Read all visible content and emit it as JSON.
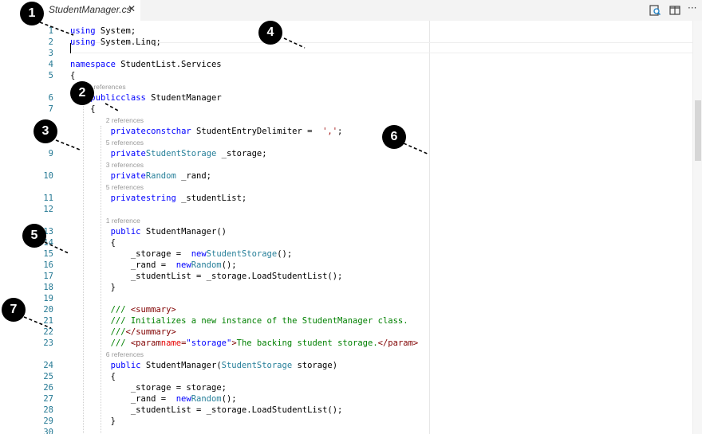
{
  "tab": {
    "title": "StudentManager.cs",
    "close": "✕"
  },
  "toolbar": {
    "icons": [
      "open-changes-icon",
      "split-editor-icon",
      "more-actions-icon"
    ],
    "more_label": "···"
  },
  "lines": [
    {
      "n": "1",
      "code": [
        [
          "kw",
          "using"
        ],
        [
          "",
          "System;"
        ]
      ]
    },
    {
      "n": "2",
      "code": [
        [
          "kw",
          "using"
        ],
        [
          "",
          "System.Linq;"
        ]
      ]
    },
    {
      "n": "3",
      "code": []
    },
    {
      "n": "4",
      "code": [
        [
          "kw",
          "namespace"
        ],
        [
          "",
          "StudentList.Services"
        ]
      ]
    },
    {
      "n": "5",
      "code": [
        [
          "",
          "{"
        ]
      ]
    },
    {
      "n": "6",
      "lens": "2 references",
      "code": [
        [
          "",
          "    "
        ],
        [
          "kw",
          "public"
        ],
        [
          "",
          ""
        ],
        [
          "kw",
          "class"
        ],
        [
          "",
          "StudentManager"
        ]
      ]
    },
    {
      "n": "7",
      "code": [
        [
          "",
          "    {"
        ]
      ]
    },
    {
      "n": "8",
      "lens": "2 references",
      "code": [
        [
          "",
          "        "
        ],
        [
          "kw",
          "private"
        ],
        [
          "",
          ""
        ],
        [
          "kw",
          "const"
        ],
        [
          "",
          ""
        ],
        [
          "kw",
          "char"
        ],
        [
          "",
          "StudentEntryDelimiter = "
        ],
        [
          "str",
          "','"
        ],
        [
          "",
          ";"
        ]
      ]
    },
    {
      "n": "9",
      "lens": "5 references",
      "code": [
        [
          "",
          "        "
        ],
        [
          "kw",
          "private"
        ],
        [
          "",
          ""
        ],
        [
          "ty",
          "StudentStorage"
        ],
        [
          "",
          "_storage;"
        ]
      ]
    },
    {
      "n": "10",
      "lens": "3 references",
      "code": [
        [
          "",
          "        "
        ],
        [
          "kw",
          "private"
        ],
        [
          "",
          ""
        ],
        [
          "ty",
          "Random"
        ],
        [
          "",
          "_rand;"
        ]
      ]
    },
    {
      "n": "11",
      "lens": "5 references",
      "code": [
        [
          "",
          "        "
        ],
        [
          "kw",
          "private"
        ],
        [
          "",
          ""
        ],
        [
          "kw",
          "string"
        ],
        [
          "",
          "_studentList;"
        ]
      ]
    },
    {
      "n": "12",
      "code": []
    },
    {
      "n": "13",
      "lens": "1 reference",
      "code": [
        [
          "",
          "        "
        ],
        [
          "kw",
          "public"
        ],
        [
          "",
          "StudentManager()"
        ]
      ]
    },
    {
      "n": "14",
      "code": [
        [
          "",
          "        {"
        ]
      ]
    },
    {
      "n": "15",
      "code": [
        [
          "",
          "            _storage = "
        ],
        [
          "kw",
          "new"
        ],
        [
          "",
          ""
        ],
        [
          "ty",
          "StudentStorage"
        ],
        [
          "",
          "();"
        ]
      ]
    },
    {
      "n": "16",
      "code": [
        [
          "",
          "            _rand = "
        ],
        [
          "kw",
          "new"
        ],
        [
          "",
          ""
        ],
        [
          "ty",
          "Random"
        ],
        [
          "",
          "();"
        ]
      ]
    },
    {
      "n": "17",
      "code": [
        [
          "",
          "            _studentList = _storage.LoadStudentList();"
        ]
      ]
    },
    {
      "n": "18",
      "code": [
        [
          "",
          "        }"
        ]
      ]
    },
    {
      "n": "19",
      "code": []
    },
    {
      "n": "20",
      "code": [
        [
          "",
          "        "
        ],
        [
          "cm",
          "///"
        ],
        [
          "xt",
          "<summary>"
        ]
      ]
    },
    {
      "n": "21",
      "code": [
        [
          "",
          "        "
        ],
        [
          "cm",
          "/// Initializes a new instance of the StudentManager class."
        ]
      ]
    },
    {
      "n": "22",
      "code": [
        [
          "",
          "        "
        ],
        [
          "cm",
          "///"
        ],
        [
          "xt",
          "</summary>"
        ]
      ]
    },
    {
      "n": "23",
      "code": [
        [
          "",
          "        "
        ],
        [
          "cm",
          "///"
        ],
        [
          "xt",
          "<param"
        ],
        [
          "",
          ""
        ],
        [
          "xa",
          "name"
        ],
        [
          "xt",
          "="
        ],
        [
          "xv",
          "\"storage\""
        ],
        [
          "xt",
          ">"
        ],
        [
          "cm",
          "The backing student storage."
        ],
        [
          "xt",
          "</param>"
        ]
      ]
    },
    {
      "n": "24",
      "lens": "6 references",
      "code": [
        [
          "",
          "        "
        ],
        [
          "kw",
          "public"
        ],
        [
          "",
          "StudentManager("
        ],
        [
          "ty",
          "StudentStorage"
        ],
        [
          "",
          "storage)"
        ]
      ]
    },
    {
      "n": "25",
      "code": [
        [
          "",
          "        {"
        ]
      ]
    },
    {
      "n": "26",
      "code": [
        [
          "",
          "            _storage = storage;"
        ]
      ]
    },
    {
      "n": "27",
      "code": [
        [
          "",
          "            _rand = "
        ],
        [
          "kw",
          "new"
        ],
        [
          "",
          ""
        ],
        [
          "ty",
          "Random"
        ],
        [
          "",
          "();"
        ]
      ]
    },
    {
      "n": "28",
      "code": [
        [
          "",
          "            _studentList = _storage.LoadStudentList();"
        ]
      ]
    },
    {
      "n": "29",
      "code": [
        [
          "",
          "        }"
        ]
      ]
    },
    {
      "n": "30",
      "code": []
    }
  ],
  "callouts": [
    {
      "label": "1"
    },
    {
      "label": "2"
    },
    {
      "label": "3"
    },
    {
      "label": "4"
    },
    {
      "label": "5"
    },
    {
      "label": "6"
    },
    {
      "label": "7"
    }
  ]
}
